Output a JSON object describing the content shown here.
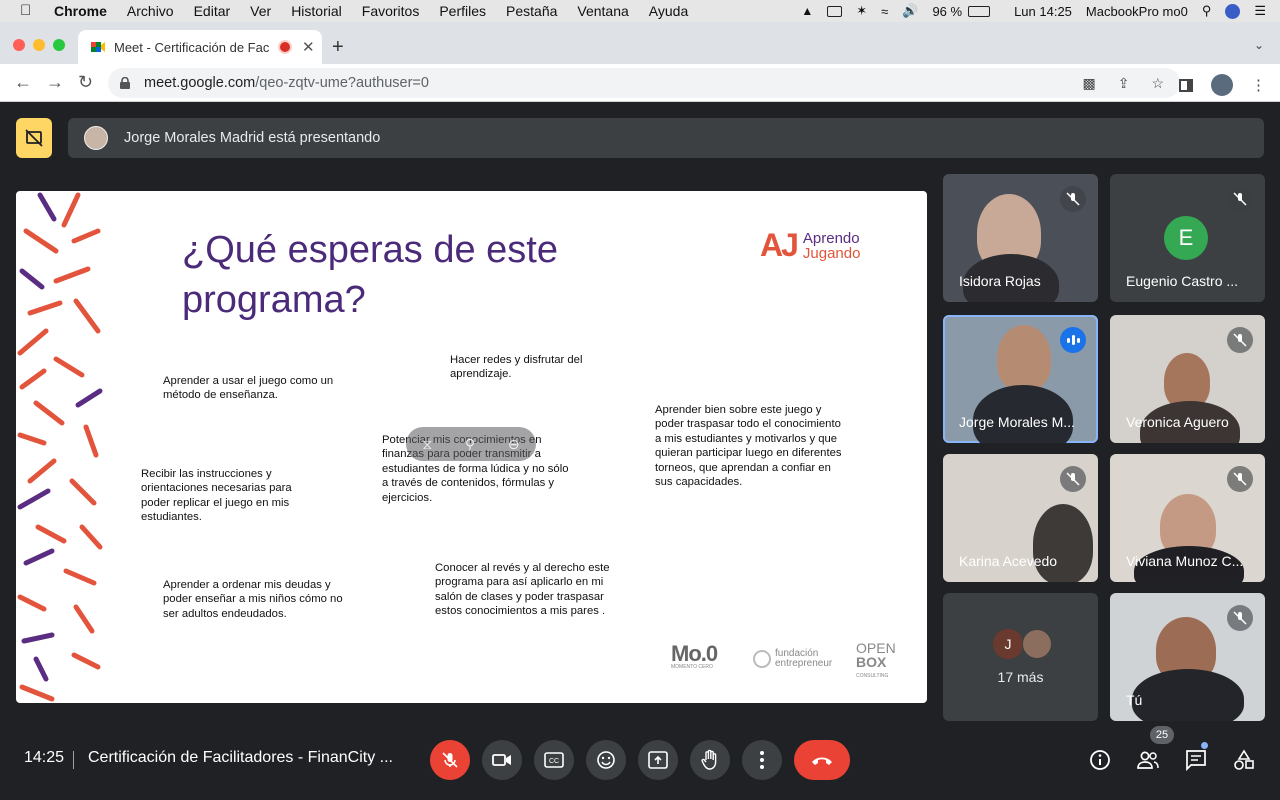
{
  "menubar": {
    "app": "Chrome",
    "items": [
      "Archivo",
      "Editar",
      "Ver",
      "Historial",
      "Favoritos",
      "Perfiles",
      "Pestaña",
      "Ventana",
      "Ayuda"
    ],
    "battery": "96 %",
    "clock": "Lun 14:25",
    "host": "MacbookPro mo0"
  },
  "tab": {
    "title": "Meet - Certificación de Fac"
  },
  "omnibox": {
    "host": "meet.google.com",
    "path": "/qeo-zqtv-ume?authuser=0"
  },
  "presenting_banner": "Jorge Morales Madrid está presentando",
  "slide": {
    "title_line1": "¿Qué esperas de este",
    "title_line2": "programa?",
    "logo_mark": "AJ",
    "logo_line1": "Aprendo",
    "logo_line2": "Jugando",
    "blocks": [
      "Aprender a usar el juego como un método de enseñanza.",
      "Hacer redes y disfrutar del aprendizaje.",
      "Potenciar mis conocimientos en finanzas para poder transmitir a estudiantes de forma lúdica y no sólo a través de contenidos, fórmulas y ejercicios.",
      "Aprender bien sobre este juego y poder traspasar todo el conocimiento a mis estudiantes y motivarlos y que quieran participar luego en diferentes torneos, que aprendan a confiar en sus capacidades.",
      "Recibir las instrucciones y orientaciones necesarias para poder replicar el juego en mis estudiantes.",
      "Aprender a ordenar mis deudas y poder enseñar a mis niños cómo no ser adultos endeudados.",
      "Conocer al revés y al derecho este programa para así aplicarlo en mi salón de clases y poder traspasar estos conocimientos a mis pares ."
    ],
    "sponsor1": "Mo.0",
    "sponsor1_sub": "MOMENTO CERO",
    "sponsor2_line1": "fundación",
    "sponsor2_line2": "entrepreneur",
    "sponsor3_line1": "OPEN",
    "sponsor3_line2": "BOX",
    "sponsor3_sub": "CONSULTING"
  },
  "participants": [
    {
      "name": "Isidora Rojas"
    },
    {
      "name": "Eugenio Castro ...",
      "initial": "E"
    },
    {
      "name": "Jorge Morales M..."
    },
    {
      "name": "Veronica Aguero"
    },
    {
      "name": "Karina Acevedo"
    },
    {
      "name": "Viviana Munoz C..."
    },
    {
      "name": "17 más",
      "initial": "J"
    },
    {
      "name": "Tú"
    }
  ],
  "bottom": {
    "time": "14:25",
    "meeting_title": "Certificación de Facilitadores - FinanCity ...",
    "participant_count": "25"
  }
}
